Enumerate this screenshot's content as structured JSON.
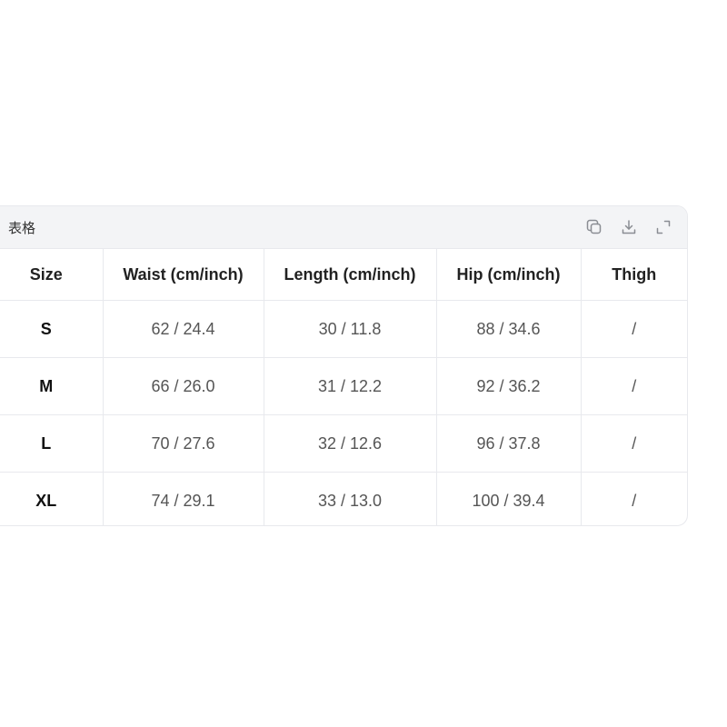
{
  "card": {
    "title": "表格",
    "toolbar": {
      "copy_icon": "copy-icon",
      "download_icon": "download-icon",
      "expand_icon": "expand-icon"
    }
  },
  "table": {
    "headers": [
      "Size",
      "Waist (cm/inch)",
      "Length (cm/inch)",
      "Hip (cm/inch)",
      "Thigh"
    ],
    "rows": [
      [
        "S",
        "62 / 24.4",
        "30 / 11.8",
        "88 / 34.6",
        "/"
      ],
      [
        "M",
        "66 / 26.0",
        "31 / 12.2",
        "92 / 36.2",
        "/"
      ],
      [
        "L",
        "70 / 27.6",
        "32 / 12.6",
        "96 / 37.8",
        "/"
      ],
      [
        "XL",
        "74 / 29.1",
        "33 / 13.0",
        "100 / 39.4",
        "/"
      ]
    ]
  },
  "colors": {
    "header_bg": "#f3f4f6",
    "border": "#e8e9ed",
    "icon": "#8a8d93"
  }
}
